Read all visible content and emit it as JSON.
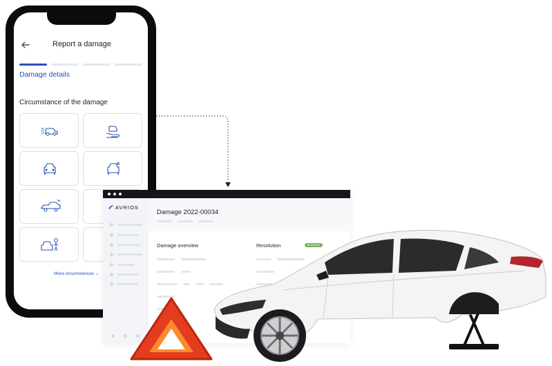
{
  "mobile": {
    "title": "Report a damage",
    "step_title": "Damage details",
    "section_title": "Circumstance of the damage",
    "more_link": "More circumstances",
    "tiles": [
      {
        "icon": "rear-collision-car-icon"
      },
      {
        "icon": "hand-holding-car-icon"
      },
      {
        "icon": "car-front-icon"
      },
      {
        "icon": "car-repair-icon"
      },
      {
        "icon": "car-side-icon"
      },
      {
        "icon": "blank-tile-icon"
      },
      {
        "icon": "car-with-person-icon"
      },
      {
        "icon": "blank-tile-icon"
      }
    ]
  },
  "desktop": {
    "logo": "AVRIOS",
    "damage_title": "Damage 2022-00034",
    "overview_title": "Damage overview",
    "resolution_title": "Resolution",
    "badge": "RESOLVED"
  },
  "colors": {
    "accent": "#2b4fb3",
    "progress_inactive": "#e4e7ee",
    "phone_frame": "#0c0c0e",
    "badge": "#7bb05f",
    "triangle_red": "#e43c1e",
    "triangle_orange": "#ff8a2e"
  },
  "decor": {
    "warning_triangle": "warning-triangle-icon",
    "car": "white-sedan-image",
    "jack": "car-jack-icon"
  }
}
